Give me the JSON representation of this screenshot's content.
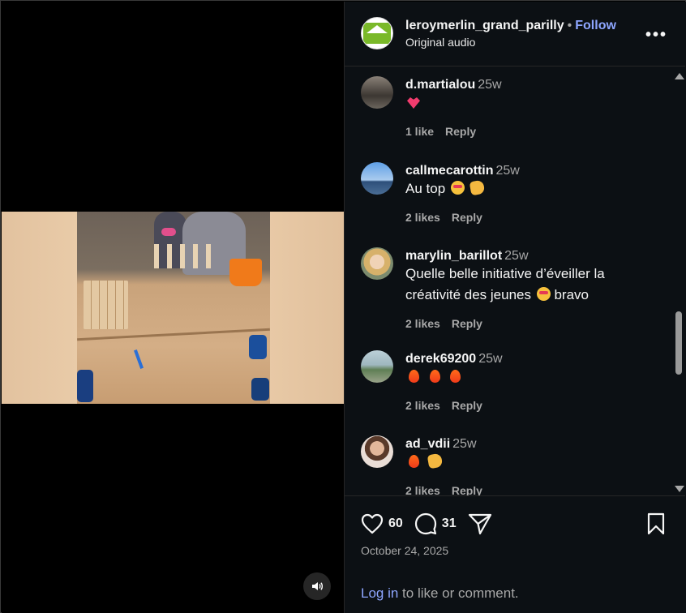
{
  "header": {
    "username": "leroymerlin_grand_parilly",
    "separator": "•",
    "follow_label": "Follow",
    "audio_label": "Original audio",
    "more_label": "•••"
  },
  "comments": [
    {
      "user": "d.martialou",
      "time": "25w",
      "text": "",
      "emojis": [
        "heart"
      ],
      "likes": "1 like",
      "reply": "Reply"
    },
    {
      "user": "callmecarottin",
      "time": "25w",
      "text": "Au top",
      "emojis": [
        "star-struck",
        "clapping-hands"
      ],
      "likes": "2 likes",
      "reply": "Reply"
    },
    {
      "user": "marylin_barillot",
      "time": "25w",
      "text_line1": "Quelle belle initiative d’éveiller la",
      "text_line2": "créativité des jeunes",
      "text_after": "bravo",
      "emojis": [
        "star-struck"
      ],
      "likes": "2 likes",
      "reply": "Reply"
    },
    {
      "user": "derek69200",
      "time": "25w",
      "text": "",
      "emojis": [
        "fire",
        "fire",
        "fire"
      ],
      "likes": "2 likes",
      "reply": "Reply"
    },
    {
      "user": "ad_vdii",
      "time": "25w",
      "text": "",
      "emojis": [
        "fire",
        "clapping-hands"
      ],
      "likes": "2 likes",
      "reply": "Reply"
    }
  ],
  "footer": {
    "like_count": "60",
    "comment_count": "31",
    "date": "October 24, 2025",
    "login_link": "Log in",
    "login_suffix": " to like or comment."
  },
  "colors": {
    "panel_bg": "#0c1014",
    "link_blue": "#8ea6ff",
    "muted_text": "#a8a8a8",
    "brand_green": "#7ab929"
  },
  "icons": [
    "heart-icon",
    "comment-icon",
    "share-icon",
    "bookmark-icon",
    "volume-icon",
    "more-icon"
  ]
}
